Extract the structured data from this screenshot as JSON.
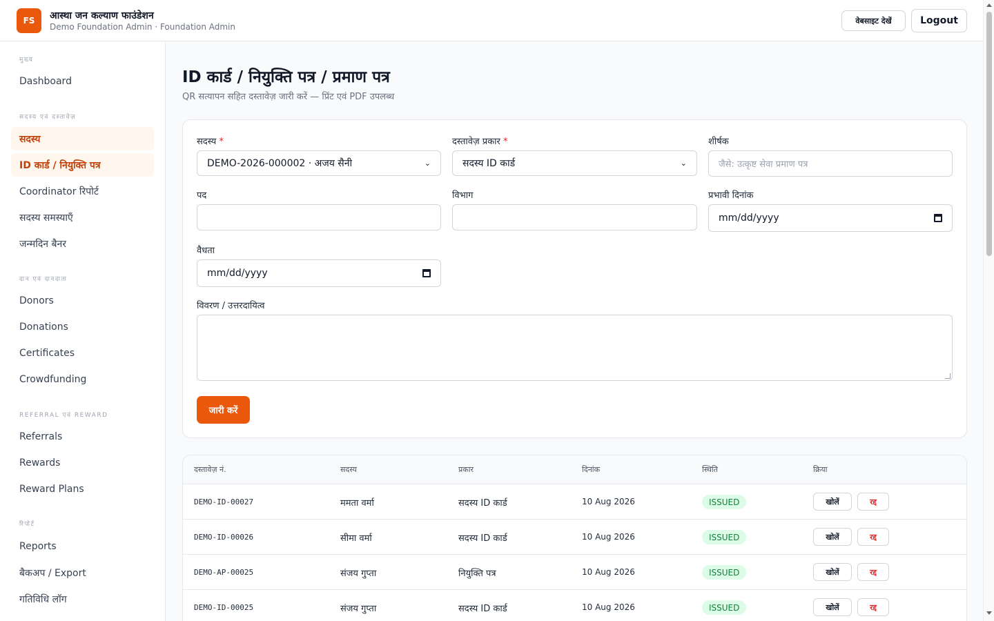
{
  "header": {
    "logo": "FS",
    "org_name": "आस्था जन कल्याण फाउंडेशन",
    "org_sub": "Demo Foundation Admin · Foundation Admin",
    "website_button": "वेबसाइट देखें",
    "logout_button": "Logout"
  },
  "sidebar": {
    "sections": [
      {
        "label": "मुख्य",
        "items": [
          "Dashboard"
        ]
      },
      {
        "label": "सदस्य एवं दस्तावेज़",
        "items": [
          "सदस्य",
          "ID कार्ड / नियुक्ति पत्र",
          "Coordinator रिपोर्ट",
          "सदस्य समस्याएँ",
          "जन्मदिन बैनर"
        ]
      },
      {
        "label": "दान एवं दानदाता",
        "items": [
          "Donors",
          "Donations",
          "Certificates",
          "Crowdfunding"
        ]
      },
      {
        "label": "Referral एवं Reward",
        "items": [
          "Referrals",
          "Rewards",
          "Reward Plans"
        ]
      },
      {
        "label": "रिपोर्ट",
        "items": [
          "Reports",
          "बैकअप / Export",
          "गतिविधि लॉग"
        ]
      }
    ],
    "active_items": [
      "सदस्य",
      "ID कार्ड / नियुक्ति पत्र"
    ]
  },
  "page": {
    "title": "ID कार्ड / नियुक्ति पत्र / प्रमाण पत्र",
    "subtitle": "QR सत्यापन सहित दस्तावेज़ जारी करें — प्रिंट एवं PDF उपलब्ध"
  },
  "form": {
    "member_label": "सदस्य",
    "member_value": "DEMO-2026-000002 · अजय सैनी",
    "doctype_label": "दस्तावेज़ प्रकार",
    "doctype_value": "सदस्य ID कार्ड",
    "title_label": "शीर्षक",
    "title_placeholder": "जैसे: उत्कृष्ट सेवा प्रमाण पत्र",
    "post_label": "पद",
    "post_value": "",
    "dept_label": "विभाग",
    "dept_value": "",
    "effective_label": "प्रभावी दिनांक",
    "effective_value": "mm/dd/yyyy",
    "validity_label": "वैधता",
    "validity_value": "mm/dd/yyyy",
    "desc_label": "विवरण / उत्तरदायित्व",
    "desc_value": "",
    "required_mark": "*",
    "submit_button": "जारी करें"
  },
  "table": {
    "headers": [
      "दस्तावेज़ नं.",
      "सदस्य",
      "प्रकार",
      "दिनांक",
      "स्थिति",
      "क्रिया"
    ],
    "open_label": "खोलें",
    "cancel_label": "रद्द",
    "rows": [
      {
        "doc_no": "DEMO-ID-00027",
        "member": "ममता वर्मा",
        "type": "सदस्य ID कार्ड",
        "date": "10 Aug 2026",
        "status": "ISSUED"
      },
      {
        "doc_no": "DEMO-ID-00026",
        "member": "सीमा वर्मा",
        "type": "सदस्य ID कार्ड",
        "date": "10 Aug 2026",
        "status": "ISSUED"
      },
      {
        "doc_no": "DEMO-AP-00025",
        "member": "संजय गुप्ता",
        "type": "नियुक्ति पत्र",
        "date": "10 Aug 2026",
        "status": "ISSUED"
      },
      {
        "doc_no": "DEMO-ID-00025",
        "member": "संजय गुप्ता",
        "type": "सदस्य ID कार्ड",
        "date": "10 Aug 2026",
        "status": "ISSUED"
      }
    ]
  },
  "colors": {
    "accent": "#ea580c",
    "active_bg": "#fff7ed",
    "status_bg": "#dcfce7",
    "status_text": "#15803d",
    "danger": "#dc2626"
  }
}
